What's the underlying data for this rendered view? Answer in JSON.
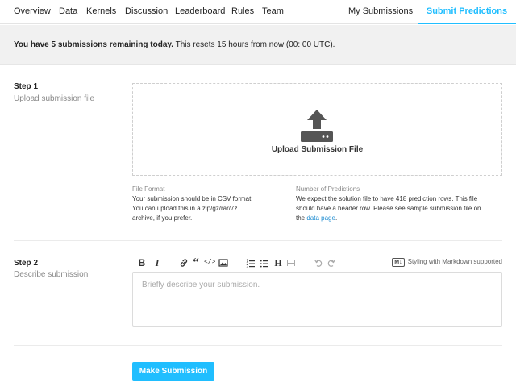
{
  "nav": {
    "items": [
      {
        "label": "Overview"
      },
      {
        "label": "Data"
      },
      {
        "label": "Kernels"
      },
      {
        "label": "Discussion"
      },
      {
        "label": "Leaderboard"
      },
      {
        "label": "Rules"
      },
      {
        "label": "Team"
      }
    ],
    "my_submissions": "My Submissions",
    "submit_predictions": "Submit Predictions",
    "accent_color": "#20beff"
  },
  "banner": {
    "bold": "You have 5 submissions remaining today.",
    "rest": " This resets 15 hours from now (00: 00 UTC)."
  },
  "step1": {
    "title": "Step 1",
    "subtitle": "Upload submission file",
    "upload_label": "Upload Submission File",
    "upload_icon": "upload-icon",
    "file_format": {
      "heading": "File Format",
      "line1": "Your submission should be in CSV format.",
      "line2": "You can upload this in a zip/gz/rar/7z",
      "line3": "archive, if you prefer."
    },
    "predictions": {
      "heading": "Number of Predictions",
      "line1": "We expect the solution file to have 418 prediction rows. This file",
      "line2": "should have a header row. Please see sample submission file on",
      "line3_prefix": "the ",
      "link": "data page",
      "line3_suffix": "."
    }
  },
  "step2": {
    "title": "Step 2",
    "subtitle": "Describe submission",
    "toolbar": {
      "bold": "B",
      "italic": "I",
      "link_icon": "link-icon",
      "quote": "“",
      "code": "</>",
      "image_icon": "image-icon",
      "ordered_list_icon": "ordered-list-icon",
      "unordered_list_icon": "unordered-list-icon",
      "heading": "H",
      "hr_icon": "horizontal-rule-icon",
      "undo_icon": "undo-icon",
      "redo_icon": "redo-icon"
    },
    "markdown_badge": "M↓",
    "markdown_note": "Styling with Markdown supported",
    "placeholder": "Briefly describe your submission."
  },
  "submit_label": "Make Submission"
}
